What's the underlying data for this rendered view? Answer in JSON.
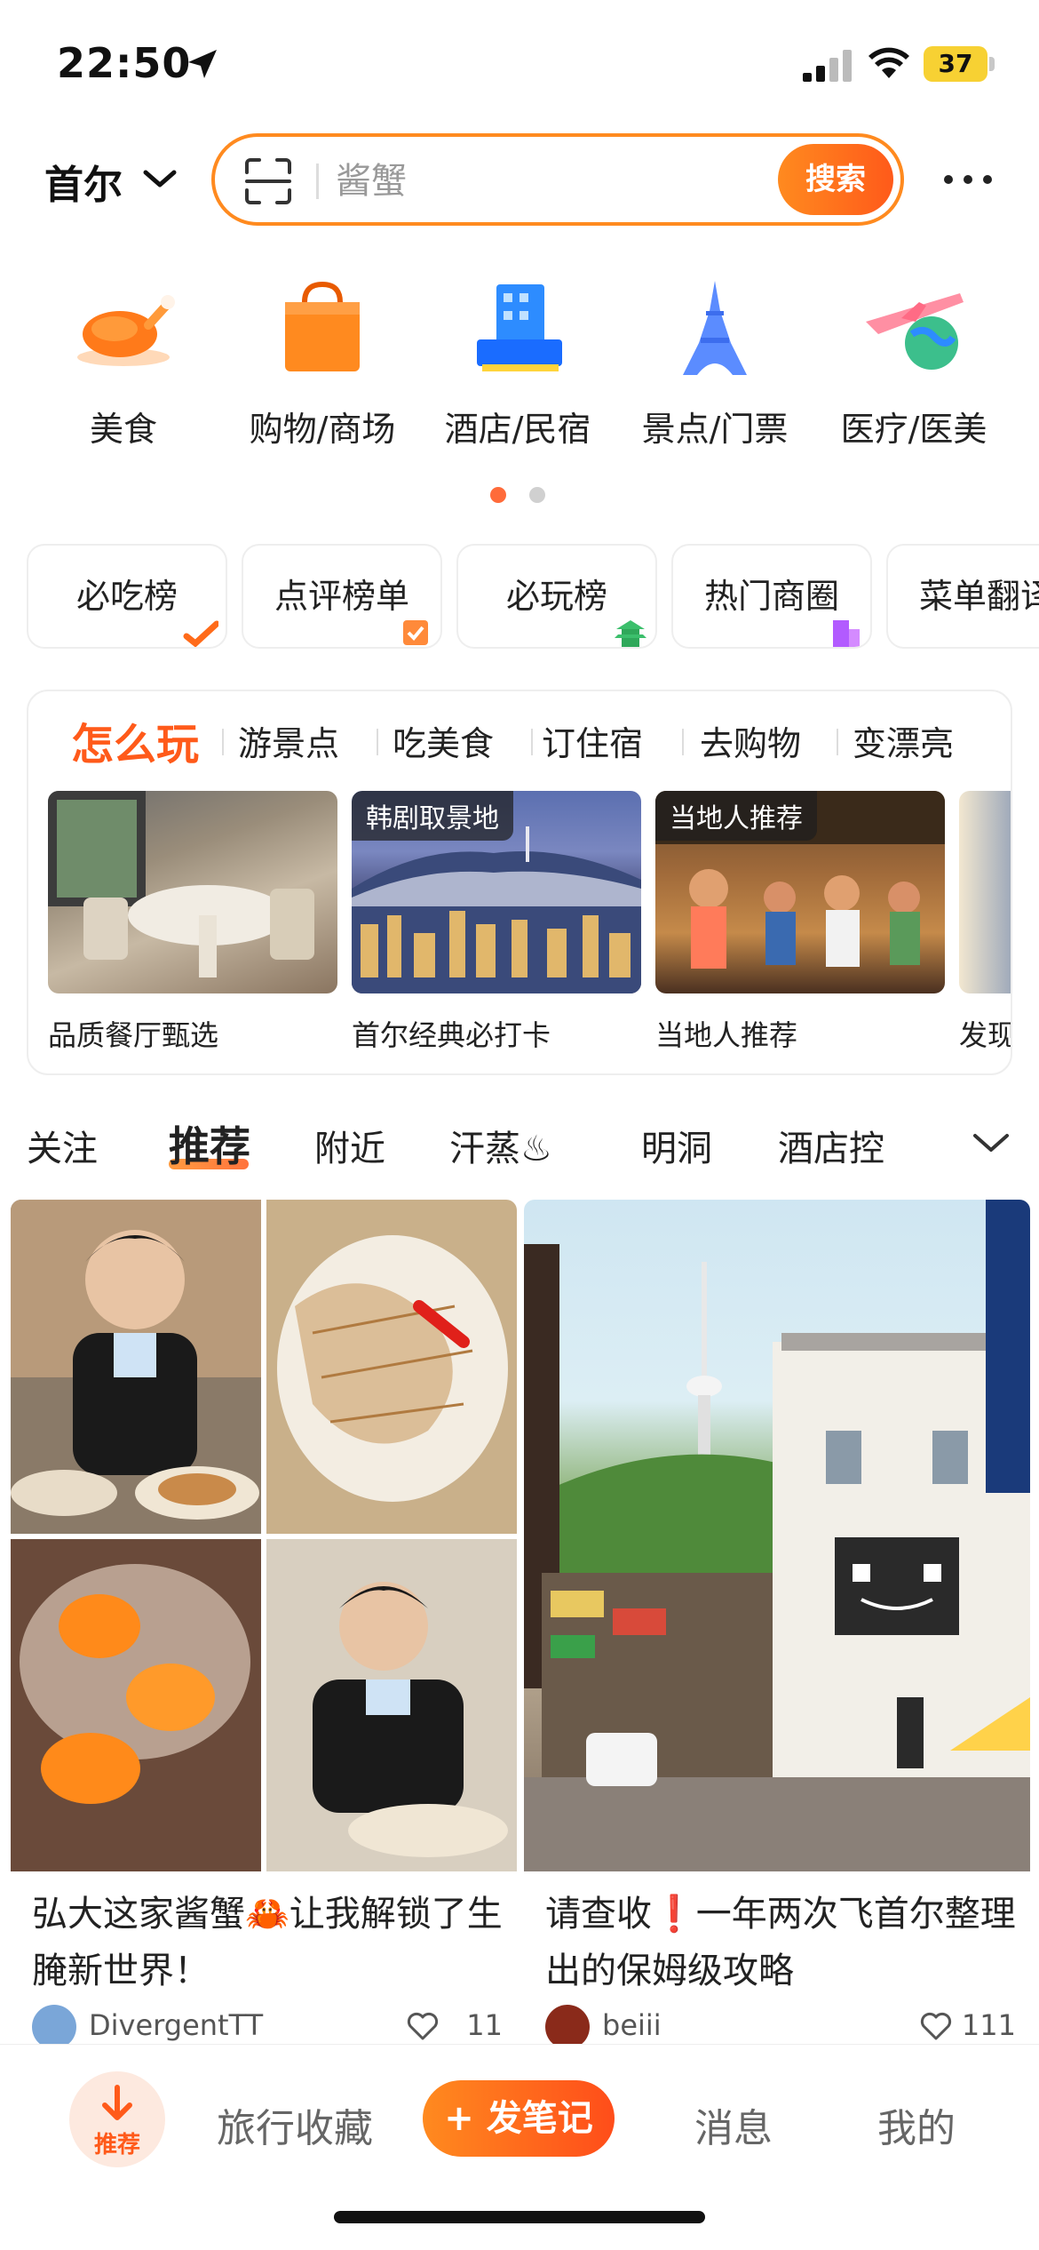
{
  "status_bar": {
    "time": "22:50",
    "battery": "37"
  },
  "header": {
    "city": "首尔",
    "search_placeholder": "酱蟹",
    "search_button": "搜索"
  },
  "categories": [
    {
      "label": "美食",
      "icon": "roast-chicken-icon"
    },
    {
      "label": "购物/商场",
      "icon": "shopping-bag-icon"
    },
    {
      "label": "酒店/民宿",
      "icon": "hotel-building-icon"
    },
    {
      "label": "景点/门票",
      "icon": "eiffel-tower-icon"
    },
    {
      "label": "医疗/医美",
      "icon": "airplane-globe-icon"
    }
  ],
  "rank_cards": [
    {
      "label": "必吃榜"
    },
    {
      "label": "点评榜单"
    },
    {
      "label": "必玩榜"
    },
    {
      "label": "热门商圈"
    },
    {
      "label": "菜单翻译"
    }
  ],
  "play_section": {
    "tabs": [
      "怎么玩",
      "游景点",
      "吃美食",
      "订住宿",
      "去购物",
      "变漂亮"
    ],
    "items": [
      {
        "caption": "品质餐厅甄选",
        "tag": ""
      },
      {
        "caption": "首尔经典必打卡",
        "tag": "韩剧取景地"
      },
      {
        "caption": "当地人推荐",
        "tag": "当地人推荐"
      },
      {
        "caption": "发现",
        "tag": ""
      }
    ]
  },
  "feed_tabs": [
    "关注",
    "推荐",
    "附近",
    "汗蒸♨",
    "明洞",
    "酒店控"
  ],
  "feed": [
    {
      "title": "弘大这家酱蟹🦀让我解锁了生腌新世界！",
      "author": "DivergentTT",
      "likes": "11"
    },
    {
      "title": "请查收❗一年两次飞首尔整理出的保姆级攻略",
      "author": "beiii",
      "likes": "111"
    }
  ],
  "bottom_nav": {
    "home": "推荐",
    "favorites": "旅行收藏",
    "post": "+ 发笔记",
    "messages": "消息",
    "me": "我的"
  },
  "colors": {
    "accent": "#ff5a1a",
    "accent_light": "#ff8a1f"
  }
}
